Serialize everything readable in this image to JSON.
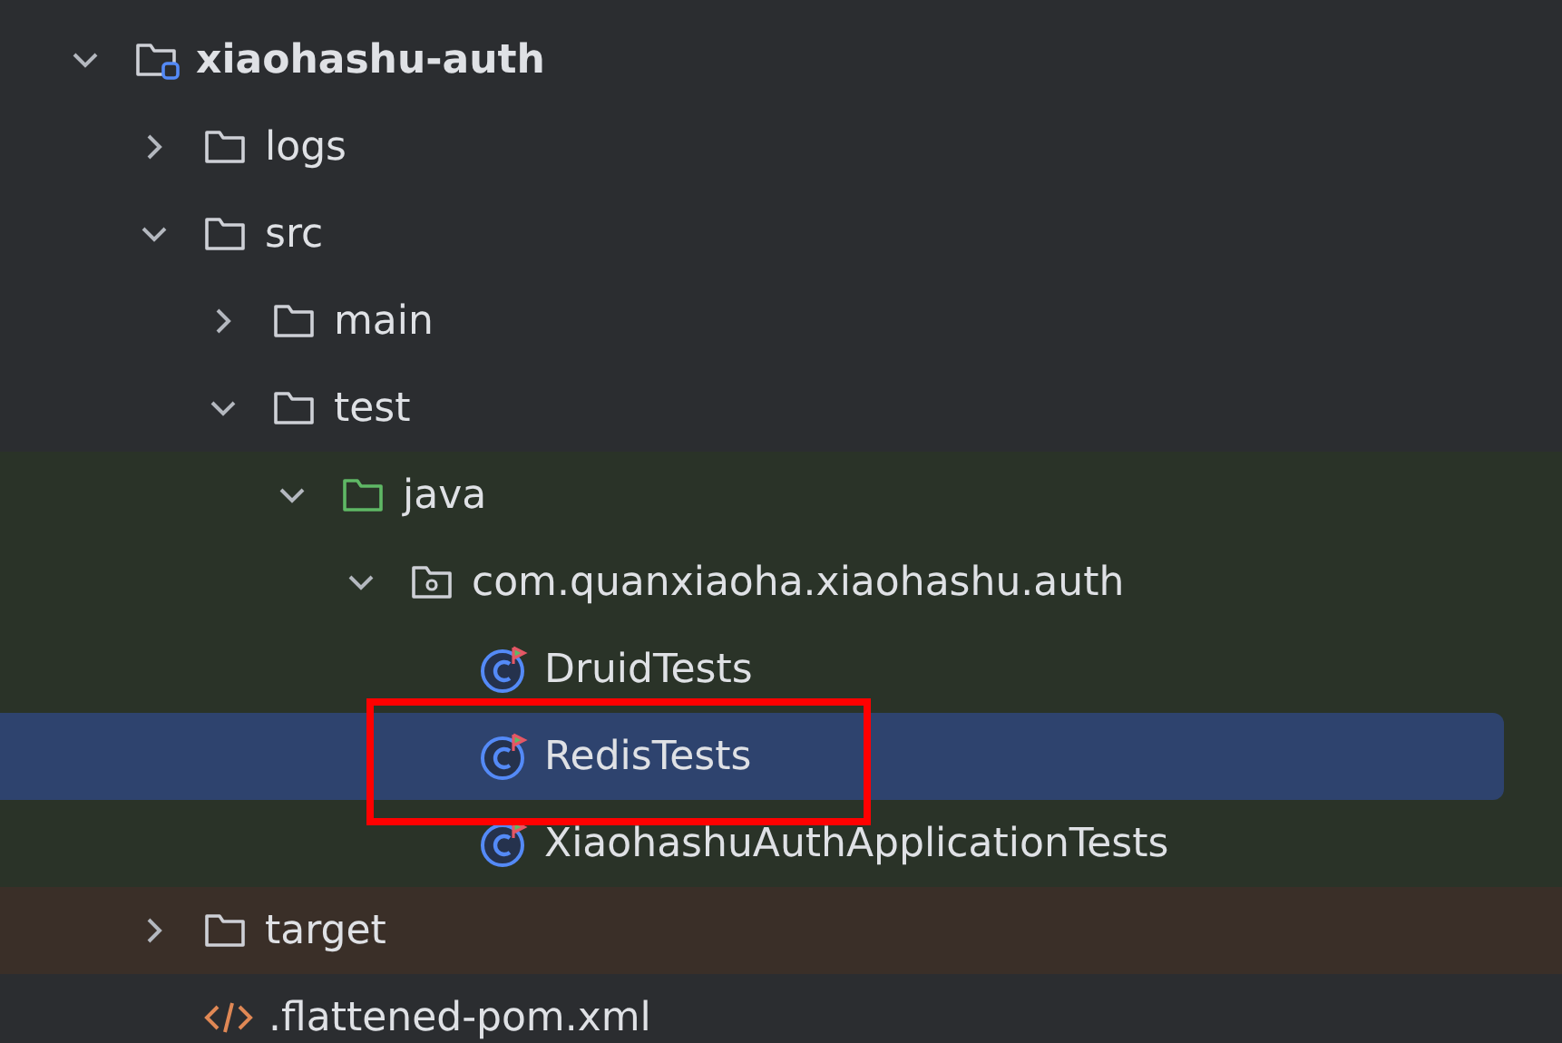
{
  "tree": [
    {
      "name": "xiaohashu-auth",
      "kind": "module",
      "expanded": true,
      "selected": false,
      "children": [
        {
          "name": "logs",
          "kind": "folder",
          "expanded": false,
          "selected": false
        },
        {
          "name": "src",
          "kind": "folder",
          "expanded": true,
          "selected": false,
          "children": [
            {
              "name": "main",
              "kind": "folder",
              "expanded": false,
              "selected": false
            },
            {
              "name": "test",
              "kind": "folder",
              "expanded": true,
              "selected": false,
              "children": [
                {
                  "name": "java",
                  "kind": "test-root",
                  "test_scope": true,
                  "expanded": true,
                  "selected": false,
                  "children": [
                    {
                      "name": "com.quanxiaoha.xiaohashu.auth",
                      "kind": "package",
                      "test_scope": true,
                      "expanded": true,
                      "selected": false,
                      "children": [
                        {
                          "name": "DruidTests",
                          "kind": "test-class",
                          "test_scope": true,
                          "selected": false,
                          "highlighted": false
                        },
                        {
                          "name": "RedisTests",
                          "kind": "test-class",
                          "test_scope": true,
                          "selected": true,
                          "highlighted": true
                        },
                        {
                          "name": "XiaohashuAuthApplicationTests",
                          "kind": "test-class",
                          "test_scope": true,
                          "selected": false,
                          "highlighted": false
                        }
                      ]
                    }
                  ]
                }
              ]
            }
          ]
        },
        {
          "name": "target",
          "kind": "folder",
          "excluded": true,
          "expanded": false,
          "selected": false
        },
        {
          "name": ".flattened-pom.xml",
          "kind": "xml-file",
          "selected": false
        }
      ]
    }
  ]
}
